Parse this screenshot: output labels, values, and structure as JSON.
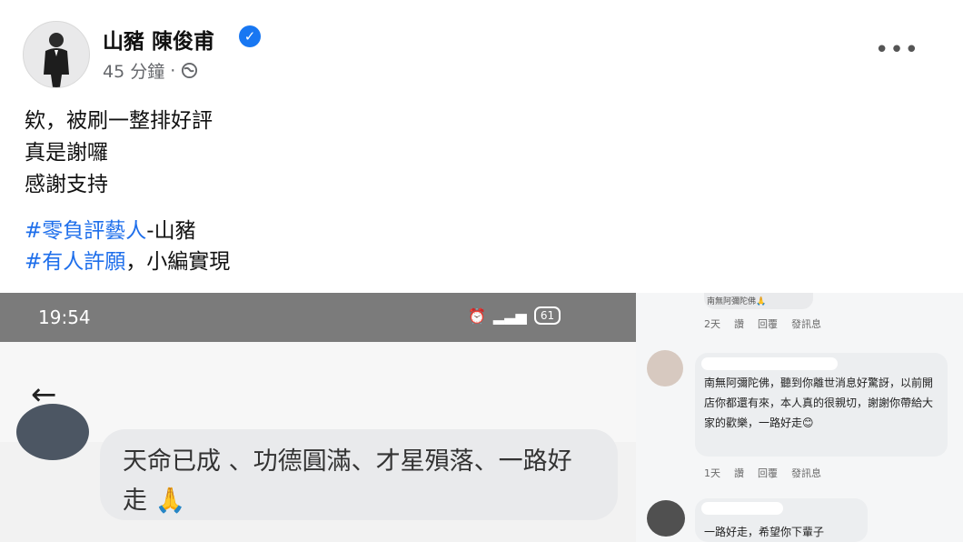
{
  "post": {
    "author": "山豬 陳俊甫",
    "time": "45 分鐘",
    "dot": "·",
    "lines": [
      "欸，被刷一整排好評",
      "真是謝囉",
      "感謝支持"
    ],
    "tag1": "#零負評藝人",
    "tag1_suffix": "-山豬",
    "tag2": "#有人許願",
    "tag2_suffix": "，小編實現"
  },
  "phone": {
    "time": "19:54",
    "battery": "61",
    "comment": "天命已成 、功德圓滿、才星殞落、一路好走 🙏"
  },
  "comments": {
    "top_text": "南無阿彌陀佛🙏",
    "actions1": [
      "2天",
      "讚",
      "回覆",
      "發訊息"
    ],
    "text1": "南無阿彌陀佛，聽到你離世消息好驚訝，以前開店你都還有來，本人真的很親切，謝謝你帶給大家的歡樂，一路好走😊",
    "actions2": [
      "1天",
      "讚",
      "回覆",
      "發訊息"
    ],
    "text2": "一路好走，希望你下輩子"
  }
}
